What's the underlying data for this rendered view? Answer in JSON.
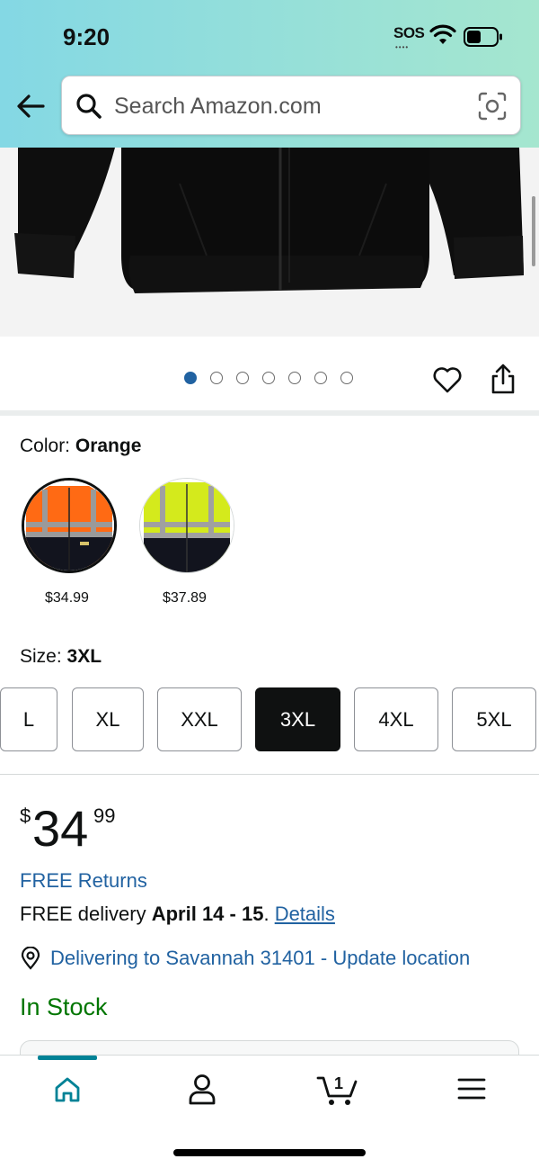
{
  "status_bar": {
    "time": "9:20",
    "sos": "SOS"
  },
  "search": {
    "placeholder": "Search Amazon.com"
  },
  "carousel": {
    "dot_count": 7,
    "active_index": 0
  },
  "color": {
    "label": "Color:",
    "selected": "Orange",
    "options": [
      {
        "name": "Orange",
        "price": "$34.99",
        "accent": "#ff6a14"
      },
      {
        "name": "Yellow",
        "price": "$37.89",
        "accent": "#d4ea1c"
      }
    ]
  },
  "size": {
    "label": "Size:",
    "selected": "3XL",
    "options": [
      "L",
      "XL",
      "XXL",
      "3XL",
      "4XL",
      "5XL"
    ]
  },
  "price": {
    "symbol": "$",
    "whole": "34",
    "fraction": "99"
  },
  "free_returns": "FREE Returns",
  "delivery": {
    "prefix": "FREE delivery",
    "dates": "April 14 - 15",
    "suffix": ".",
    "details_link": "Details"
  },
  "location": {
    "text": "Delivering to Savannah 31401 - Update location"
  },
  "stock": "In Stock",
  "nav": {
    "cart_count": "1",
    "active_color": "#008296"
  },
  "colors": {
    "link": "#2162a1",
    "in_stock": "#007600",
    "header_start": "#84d8e4",
    "header_end": "#a5e6cf"
  }
}
